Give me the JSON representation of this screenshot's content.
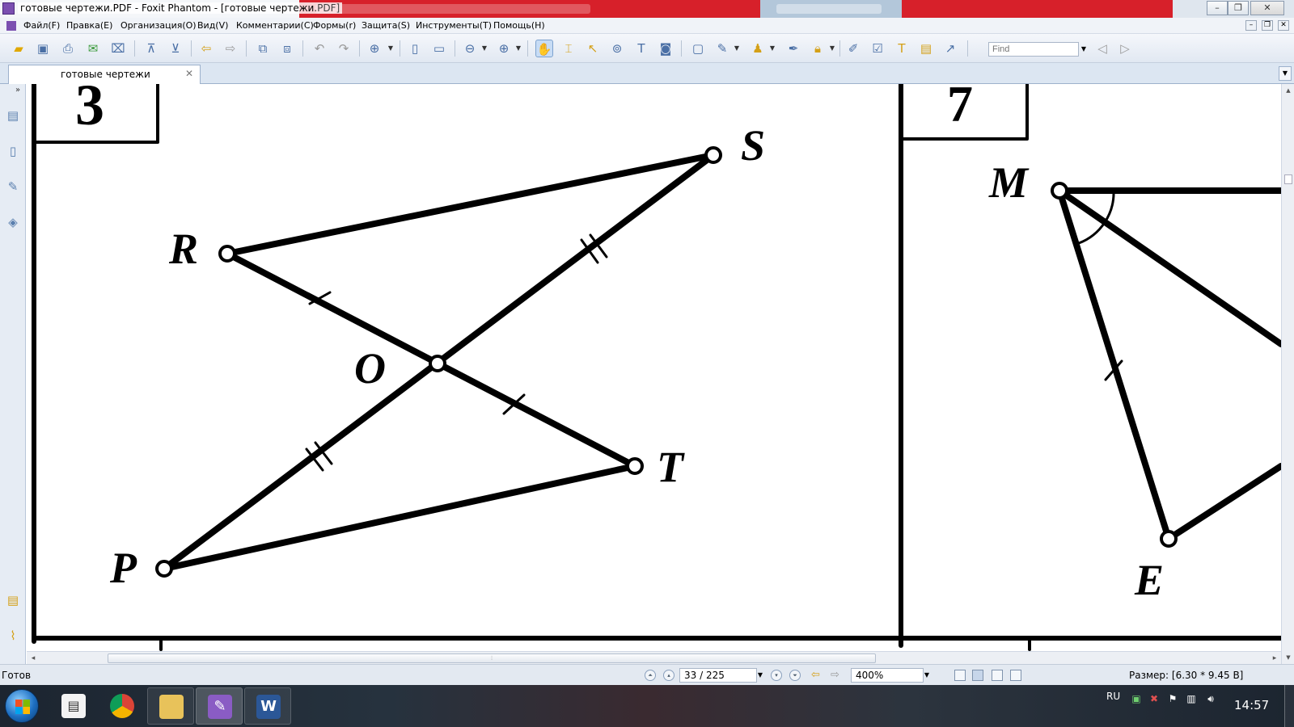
{
  "window": {
    "title": "готовые чертежи.PDF - Foxit Phantom - [готовые чертежи.PDF]",
    "controls": [
      "–",
      "❐",
      "✕"
    ]
  },
  "menu": {
    "items": [
      "Файл(F)",
      "Правка(E)",
      "Организация(O)",
      "Вид(V)",
      "Комментарии(C)",
      "Формы(r)",
      "Защита(S)",
      "Инструменты(T)",
      "Помощь(H)"
    ],
    "window_controls": [
      "–",
      "❐",
      "✕"
    ]
  },
  "toolbar": {
    "find_placeholder": "Find"
  },
  "tab": {
    "label": "готовые чертежи",
    "close": "✕"
  },
  "document": {
    "figure_left": {
      "number": "3",
      "labels": {
        "s": "S",
        "r": "R",
        "o": "O",
        "t": "T",
        "p": "P"
      }
    },
    "figure_right": {
      "number": "7",
      "labels": {
        "m": "M",
        "e": "E"
      }
    }
  },
  "statusbar": {
    "ready": "Готов",
    "page": "33 / 225",
    "zoom": "400%",
    "size": "Размер: [6.30 * 9.45 В]"
  },
  "taskbar": {
    "language": "RU",
    "time": "14:57",
    "apps": [
      "explorer",
      "chrome",
      "file-manager",
      "foxit-phantom",
      "word"
    ],
    "word_glyph": "W"
  }
}
